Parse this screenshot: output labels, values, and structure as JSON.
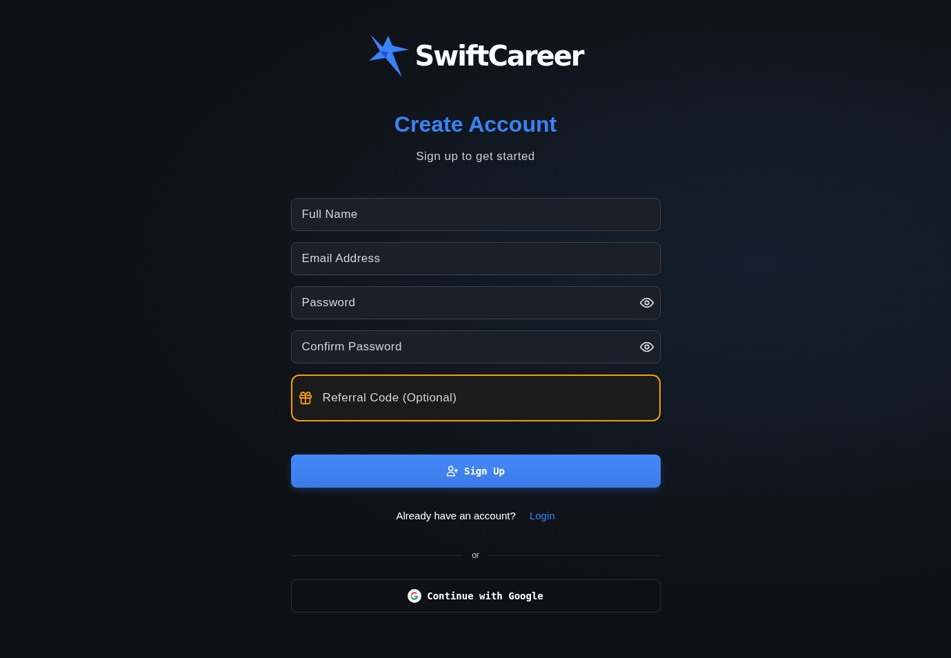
{
  "brand": {
    "name": "SwiftCareer"
  },
  "heading": "Create Account",
  "subheading": "Sign up to get started",
  "fields": [
    {
      "kind": "text",
      "placeholder": "Full Name"
    },
    {
      "kind": "text",
      "placeholder": "Email Address"
    },
    {
      "kind": "password",
      "placeholder": "Password"
    },
    {
      "kind": "password",
      "placeholder": "Confirm Password"
    },
    {
      "kind": "referral",
      "placeholder": "Referral Code (Optional)"
    }
  ],
  "submit": "Sign Up",
  "login_prompt": {
    "text": "Already have an account?",
    "link": "Login"
  },
  "divider": "or",
  "google_button": "Continue with Google"
}
